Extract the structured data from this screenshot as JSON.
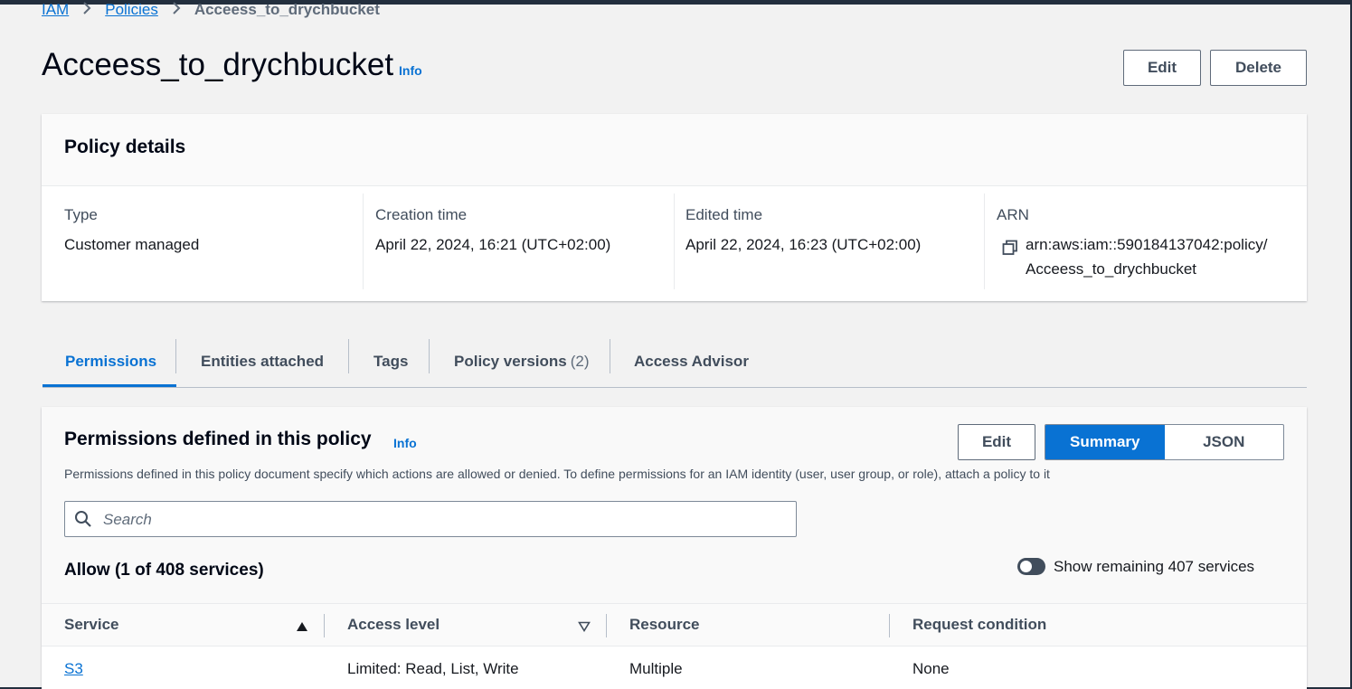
{
  "breadcrumb": {
    "items": [
      {
        "label": "IAM"
      },
      {
        "label": "Policies"
      }
    ],
    "current": "Acceess_to_drychbucket"
  },
  "page": {
    "title": "Acceess_to_drychbucket",
    "info": "Info",
    "edit_label": "Edit",
    "delete_label": "Delete"
  },
  "details": {
    "title": "Policy details",
    "type": {
      "label": "Type",
      "value": "Customer managed"
    },
    "creation": {
      "label": "Creation time",
      "value": "April 22, 2024, 16:21 (UTC+02:00)"
    },
    "edited": {
      "label": "Edited time",
      "value": "April 22, 2024, 16:23 (UTC+02:00)"
    },
    "arn": {
      "label": "ARN",
      "line1": "arn:aws:iam::590184137042:policy/",
      "line2": "Acceess_to_drychbucket",
      "icon": "copy-icon"
    }
  },
  "tabs": {
    "permissions": "Permissions",
    "entities": "Entities attached",
    "tags": "Tags",
    "versions": "Policy versions",
    "versions_count": "(2)",
    "advisor": "Access Advisor",
    "active": "Permissions"
  },
  "permissions": {
    "title": "Permissions defined in this policy",
    "info": "Info",
    "description": "Permissions defined in this policy document specify which actions are allowed or denied. To define permissions for an IAM identity (user, user group, or role), attach a policy to it",
    "edit_label": "Edit",
    "summary_label": "Summary",
    "json_label": "JSON",
    "selected_view": "Summary",
    "search_placeholder": "Search",
    "search_value": "",
    "allow_title": "Allow (1 of 408 services)",
    "toggle_label": "Show remaining 407 services",
    "toggle_on": false,
    "columns": {
      "service": "Service",
      "access_level": "Access level",
      "resource": "Resource",
      "request_condition": "Request condition"
    },
    "rows": [
      {
        "service": "S3",
        "access_level": "Limited: Read, List, Write",
        "resource": "Multiple",
        "request_condition": "None"
      }
    ]
  },
  "colors": {
    "accent": "#0972d3",
    "dark_bar": "#232f3e",
    "text": "#16191f",
    "muted": "#414d5c"
  }
}
